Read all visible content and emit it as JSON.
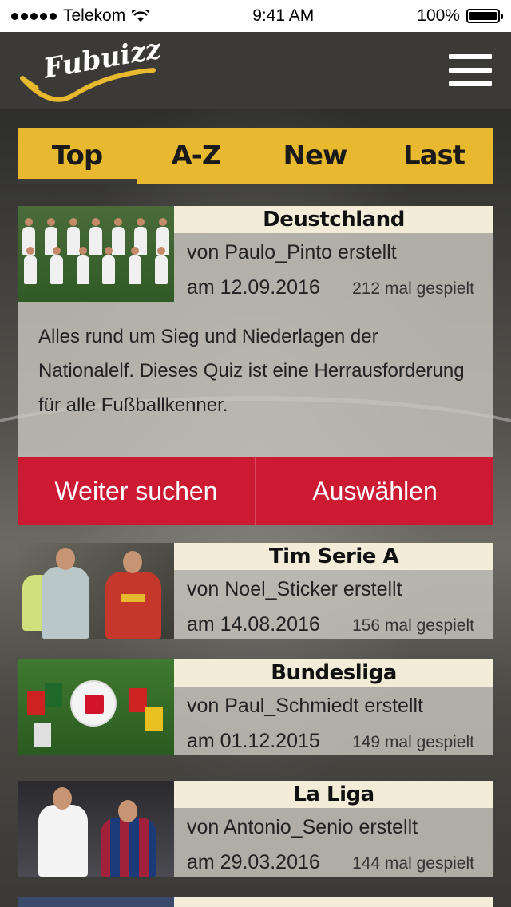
{
  "status_bar": {
    "carrier": "Telekom",
    "time": "9:41 AM",
    "battery": "100%"
  },
  "header": {
    "logo_text": "Fubuizz"
  },
  "tabs": [
    {
      "label": "Top",
      "active": true
    },
    {
      "label": "A-Z",
      "active": false
    },
    {
      "label": "New",
      "active": false
    },
    {
      "label": "Last",
      "active": false
    }
  ],
  "quizzes": [
    {
      "title": "Deustchland",
      "author": "von Paulo_Pinto erstellt",
      "date": "am 12.09.2016",
      "plays": "212 mal gespielt",
      "description": "Alles rund um Sieg und Niederlagen der Nationalelf. Dieses Quiz ist eine Herrausforderung für alle Fußballkenner."
    },
    {
      "title": "Tim Serie A",
      "author": "von Noel_Sticker erstellt",
      "date": "am 14.08.2016",
      "plays": "156 mal gespielt"
    },
    {
      "title": "Bundesliga",
      "author": "von Paul_Schmiedt erstellt",
      "date": "am 01.12.2015",
      "plays": "149 mal gespielt"
    },
    {
      "title": "La Liga",
      "author": "von Antonio_Senio erstellt",
      "date": "am 29.03.2016",
      "plays": "144 mal gespielt"
    }
  ],
  "actions": {
    "continue_search": "Weiter suchen",
    "select": "Auswählen"
  },
  "colors": {
    "accent_yellow": "#e8b92f",
    "action_red": "#cc1a33",
    "header_dark": "#3b3a36"
  }
}
